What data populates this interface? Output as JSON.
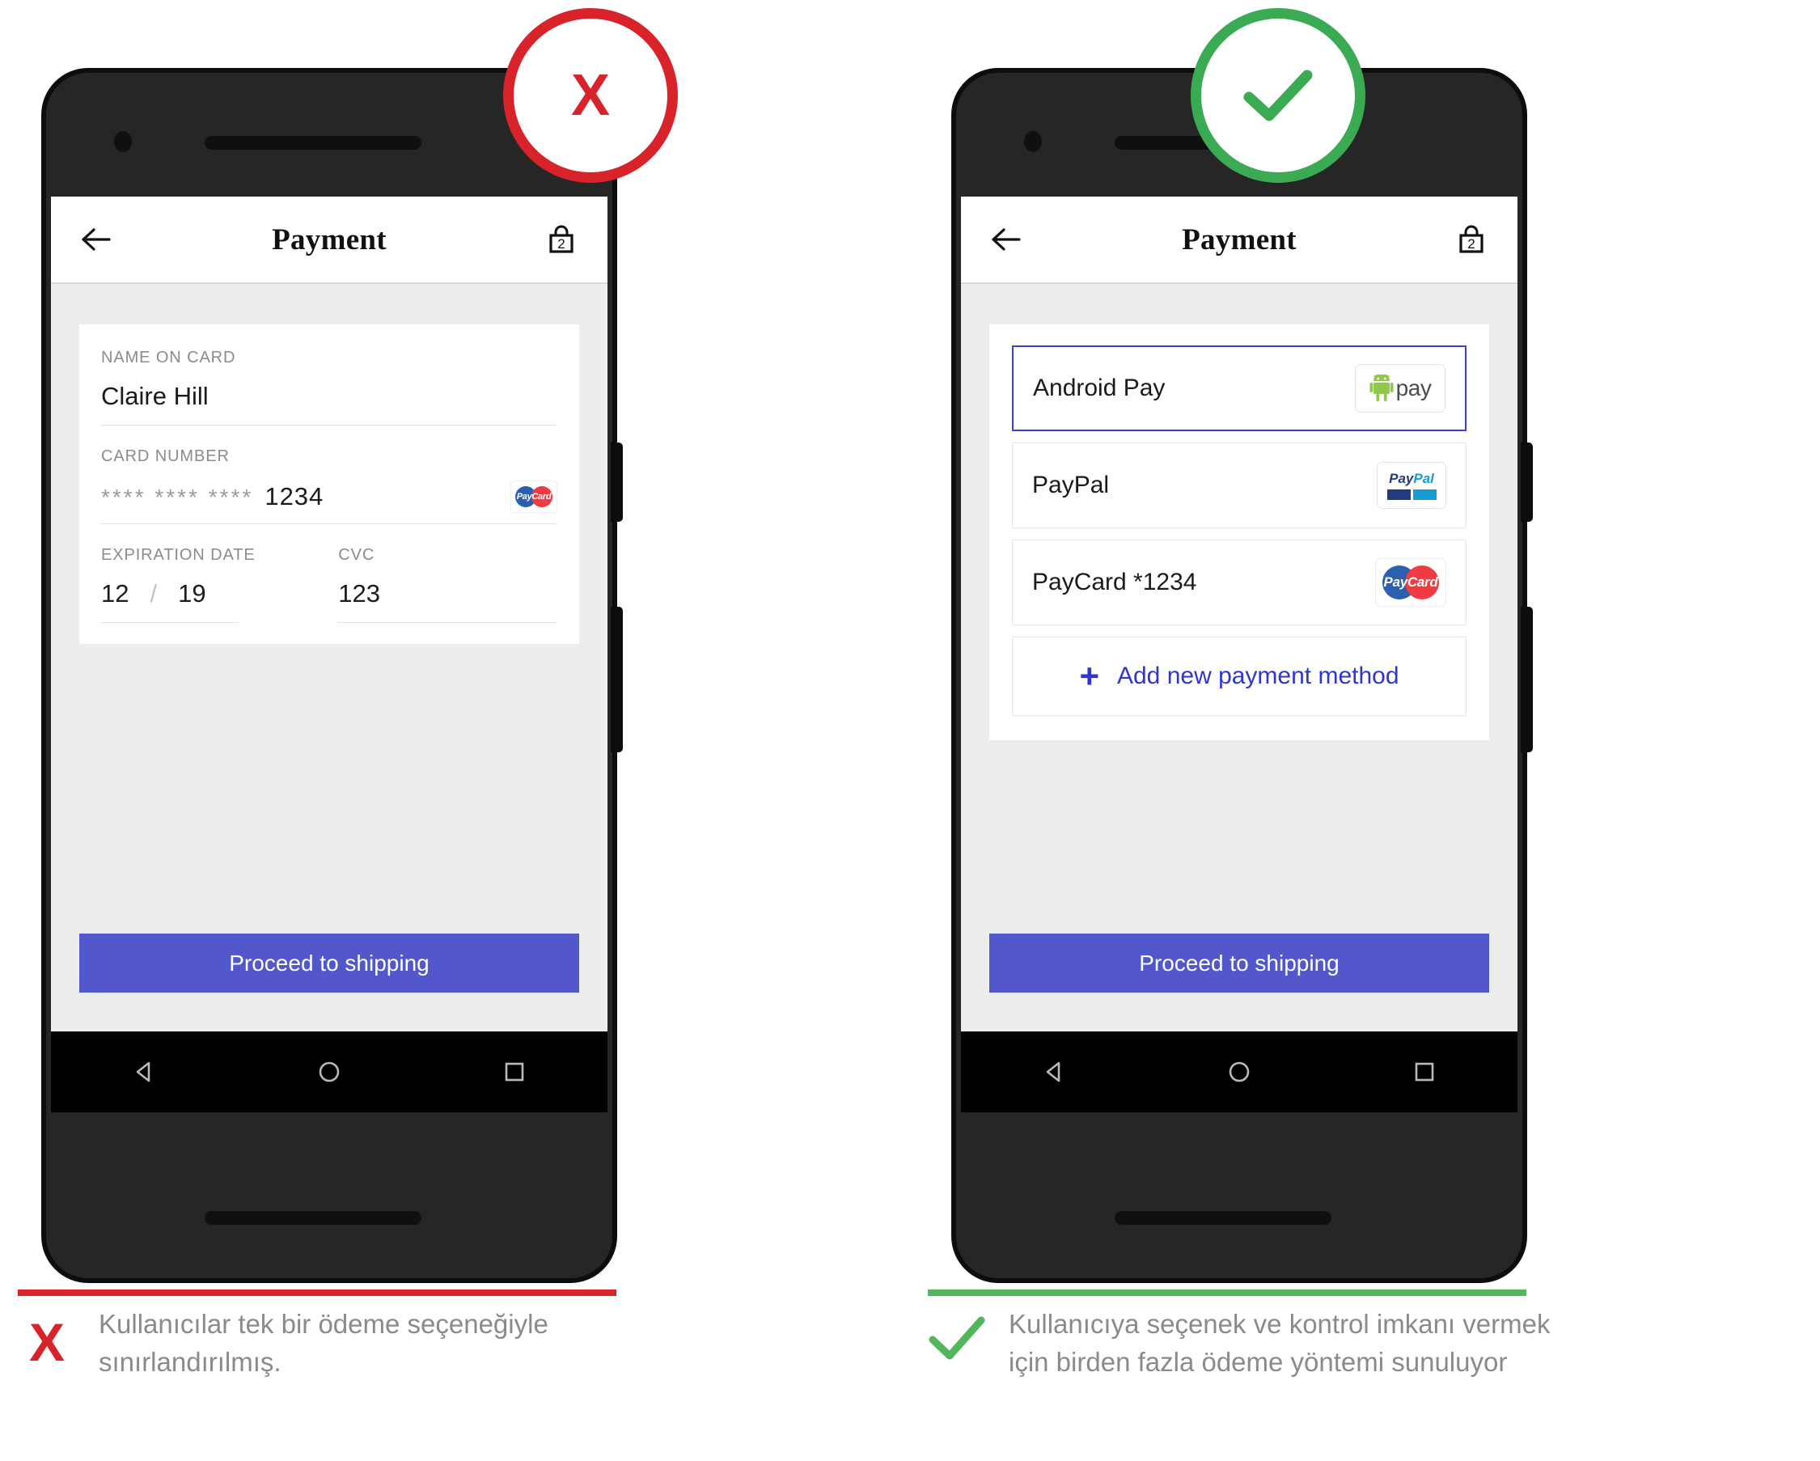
{
  "badges": {
    "bad": {
      "icon": "x-icon",
      "glyph": "X",
      "color": "#d8232a"
    },
    "good": {
      "icon": "check-icon",
      "color": "#3aab52"
    }
  },
  "bad_example": {
    "appbar": {
      "back_icon": "arrow-left-icon",
      "title": "Payment",
      "bag_icon": "shopping-bag-icon",
      "bag_count": "2"
    },
    "form": {
      "name_label": "NAME ON CARD",
      "name_value": "Claire Hill",
      "card_label": "CARD NUMBER",
      "card_masked": "**** **** ****",
      "card_last4": "1234",
      "card_brand": "PayCard",
      "card_brand_pay": "Pay",
      "card_brand_card": "Card",
      "exp_label": "EXPIRATION DATE",
      "exp_month": "12",
      "exp_sep": "/",
      "exp_year": "19",
      "cvc_label": "CVC",
      "cvc_value": "123"
    },
    "cta_label": "Proceed to shipping",
    "nav": {
      "back": "nav-back-icon",
      "home": "nav-home-icon",
      "recents": "nav-recents-icon"
    }
  },
  "good_example": {
    "appbar": {
      "back_icon": "arrow-left-icon",
      "title": "Payment",
      "bag_icon": "shopping-bag-icon",
      "bag_count": "2"
    },
    "methods": [
      {
        "label": "Android Pay",
        "logo": "android-pay-logo",
        "logo_text": "pay",
        "selected": true
      },
      {
        "label": "PayPal",
        "logo": "paypal-logo",
        "logo_pay": "Pay",
        "logo_pal": "Pal",
        "selected": false
      },
      {
        "label": "PayCard *1234",
        "logo": "paycard-logo",
        "logo_pay": "Pay",
        "logo_card": "Card",
        "selected": false
      }
    ],
    "add_method": {
      "plus": "+",
      "label": "Add new payment method"
    },
    "cta_label": "Proceed to shipping",
    "nav": {
      "back": "nav-back-icon",
      "home": "nav-home-icon",
      "recents": "nav-recents-icon"
    }
  },
  "captions": {
    "bad": "Kullanıcılar tek bir ödeme seçeneğiyle sınırlandırılmış.",
    "good": "Kullanıcıya seçenek ve kontrol imkanı vermek için birden fazla ödeme yöntemi sunuluyor"
  }
}
